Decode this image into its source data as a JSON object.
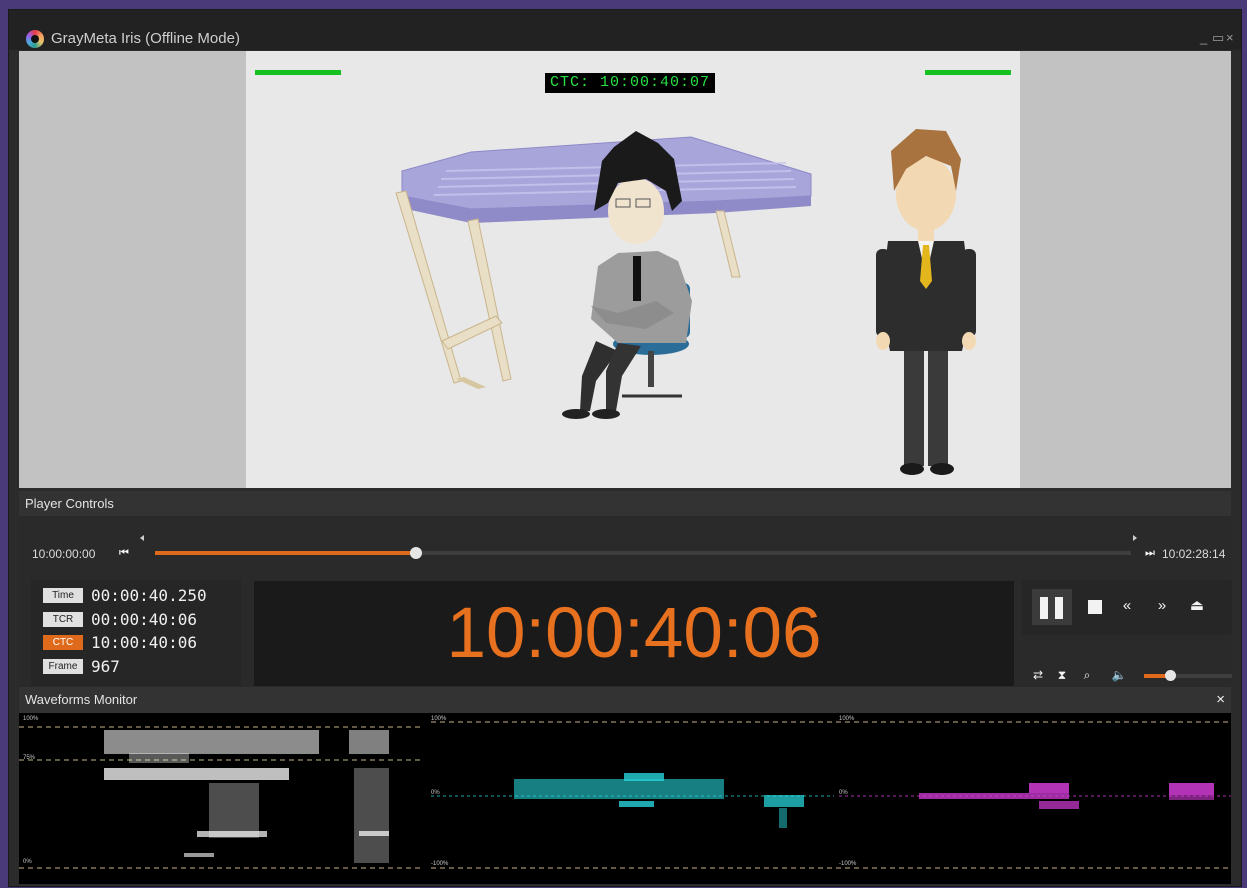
{
  "window": {
    "title": "GrayMeta Iris (Offline Mode)",
    "minimize": "_",
    "maximize": "▭",
    "close": "×"
  },
  "video": {
    "overlay_label": "CTC:",
    "overlay_time": "10:00:40:07",
    "colors": {
      "letterbox": "#c2c2c2",
      "background": "#e8e8e8",
      "safe_bar": "#16c11f"
    }
  },
  "player_controls": {
    "header": "Player Controls",
    "start_time": "10:00:00:00",
    "end_time": "10:02:28:14",
    "progress_fraction": 0.267,
    "timecodes": [
      {
        "tag": "Time",
        "value": "00:00:40.250",
        "active": false
      },
      {
        "tag": "TCR",
        "value": "00:00:40:06",
        "active": false
      },
      {
        "tag": "CTC",
        "value": "10:00:40:06",
        "active": true
      },
      {
        "tag": "Frame",
        "value": "967",
        "active": false
      }
    ],
    "big_timecode": "10:00:40:06",
    "volume_fraction": 0.3,
    "accent_color": "#e06a1b"
  },
  "waveforms": {
    "header": "Waveforms Monitor",
    "close": "×",
    "luma": {
      "top": "100%",
      "mid": "75%",
      "bottom": "0%"
    },
    "cb": {
      "top": "100%",
      "mid": "0%",
      "bottom": "-100%"
    },
    "cr": {
      "top": "100%",
      "mid": "0%",
      "bottom": "-100%"
    },
    "colors": {
      "luma": "#ffffff",
      "cb": "#27d3d9",
      "cr": "#d23cd6",
      "guide": "#e7d59a"
    }
  }
}
